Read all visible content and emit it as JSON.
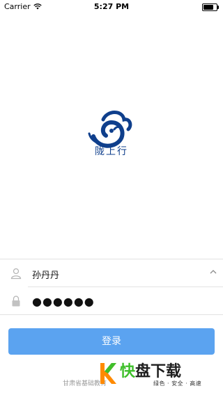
{
  "status_bar": {
    "carrier": "Carrier",
    "time": "5:27 PM",
    "battery_level": 0.9
  },
  "app": {
    "logo_icon": "swirl-cloud-logo",
    "logo_caption": "陇上行"
  },
  "form": {
    "username": "孙丹丹",
    "password_masked": "●●●●●●",
    "user_icon": "user-icon",
    "lock_icon": "lock-icon",
    "dropdown_icon": "chevron-up-icon"
  },
  "login_button": {
    "label": "登录"
  },
  "footer": {
    "text": "甘肃省基础教育"
  },
  "watermark": {
    "title_prefix": "快",
    "title_rest": "盘下载",
    "subtitle": "绿色 · 安全 · 高速"
  },
  "colors": {
    "accent": "#5ba3f0",
    "logo": "#0f3f8c",
    "watermark_green": "#3fbf2b"
  }
}
